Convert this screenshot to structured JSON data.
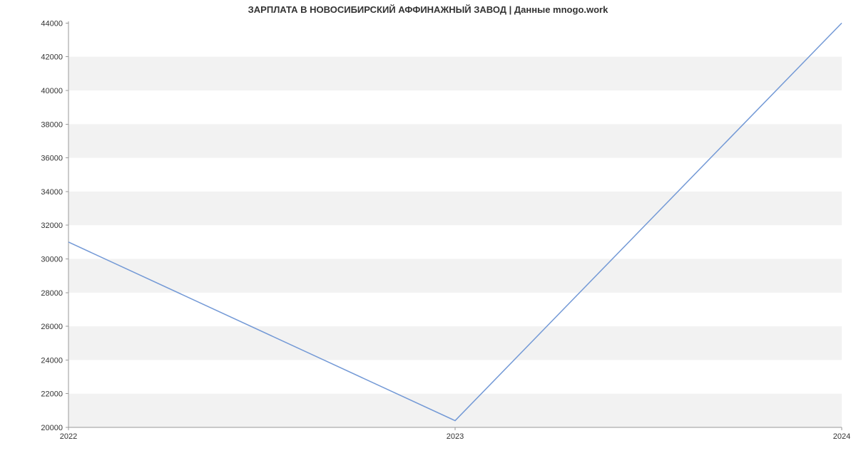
{
  "chart_data": {
    "type": "line",
    "title": "ЗАРПЛАТА В  НОВОСИБИРСКИЙ АФФИНАЖНЫЙ ЗАВОД | Данные mnogo.work",
    "x": [
      2022,
      2023,
      2024
    ],
    "values": [
      31000,
      20400,
      44000
    ],
    "x_ticks": [
      2022,
      2023,
      2024
    ],
    "y_ticks": [
      20000,
      22000,
      24000,
      26000,
      28000,
      30000,
      32000,
      34000,
      36000,
      38000,
      40000,
      42000,
      44000
    ],
    "xlim": [
      2022,
      2024
    ],
    "ylim": [
      20000,
      44100
    ],
    "xlabel": "",
    "ylabel": "",
    "grid": "horizontal-bands"
  }
}
